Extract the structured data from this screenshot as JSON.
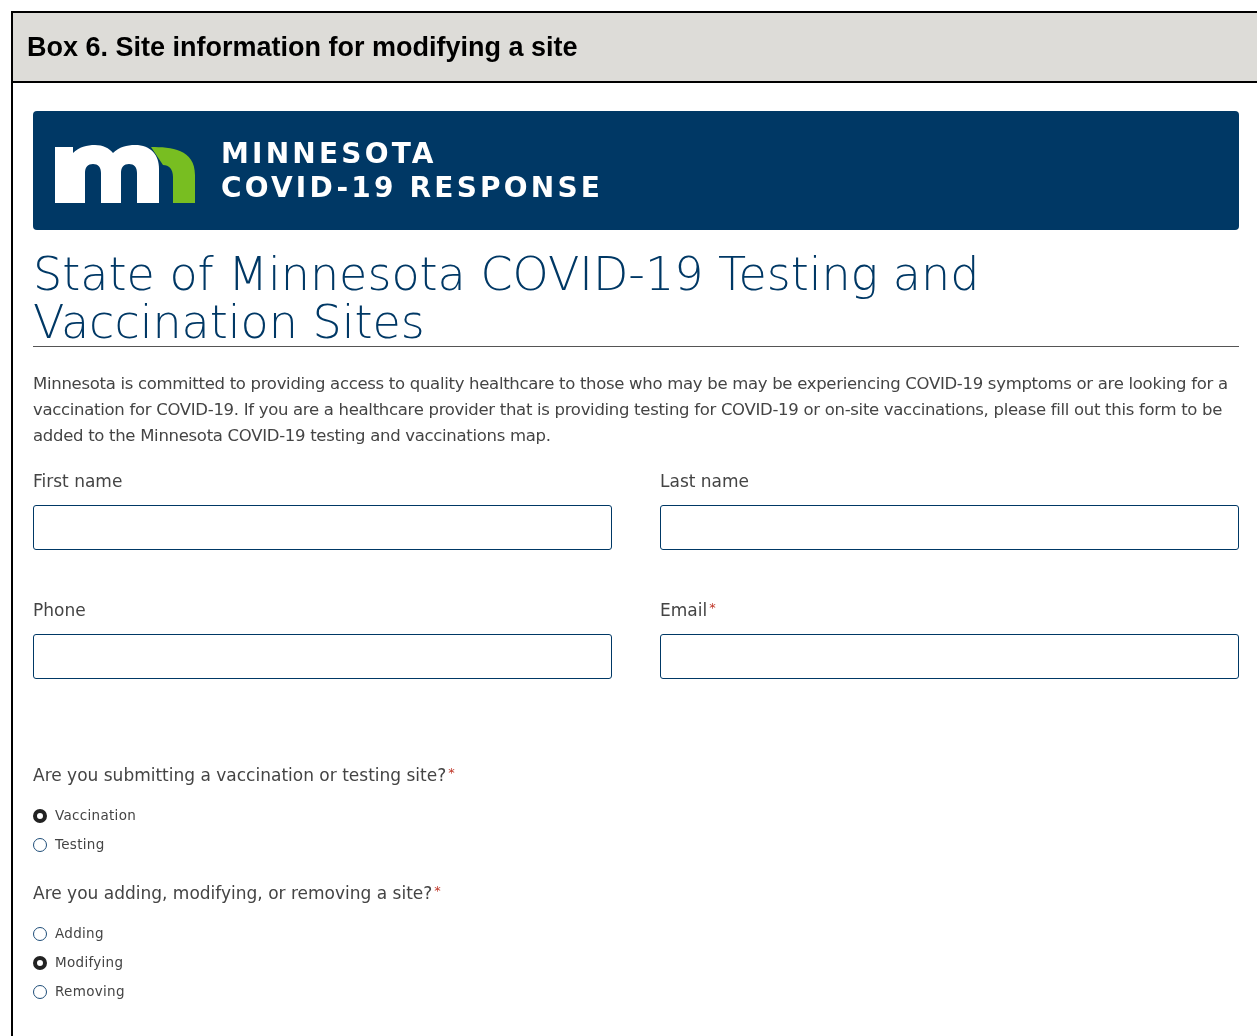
{
  "box_title": "Box 6. Site information for modifying a site",
  "banner": {
    "line_1": "MINNESOTA",
    "line_2": "COVID-19 RESPONSE"
  },
  "page_title": "State of Minnesota COVID-19 Testing and Vaccination Sites",
  "intro": "Minnesota is committed to providing access to quality healthcare to those who may be may be experiencing COVID-19 symptoms or are looking for a vaccination for COVID-19. If you are a healthcare provider that is providing testing for COVID-19 or on-site vaccinations, please fill out this form to be added to the Minnesota COVID-19 testing and vaccinations map.",
  "fields": [
    {
      "label": "First name"
    },
    {
      "label": "Last name"
    },
    {
      "label": "Phone"
    },
    {
      "label": "Email",
      "required_mark": "*"
    }
  ],
  "questions": [
    {
      "label": "Are you submitting a vaccination or testing site?",
      "required_mark": "*",
      "options": [
        {
          "label": "Vaccination",
          "selected": true
        },
        {
          "label": "Testing",
          "selected": false
        }
      ]
    },
    {
      "label": "Are you adding, modifying, or removing a site?",
      "required_mark": "*",
      "options": [
        {
          "label": "Adding",
          "selected": false
        },
        {
          "label": "Modifying",
          "selected": true
        },
        {
          "label": "Removing",
          "selected": false
        }
      ]
    }
  ]
}
